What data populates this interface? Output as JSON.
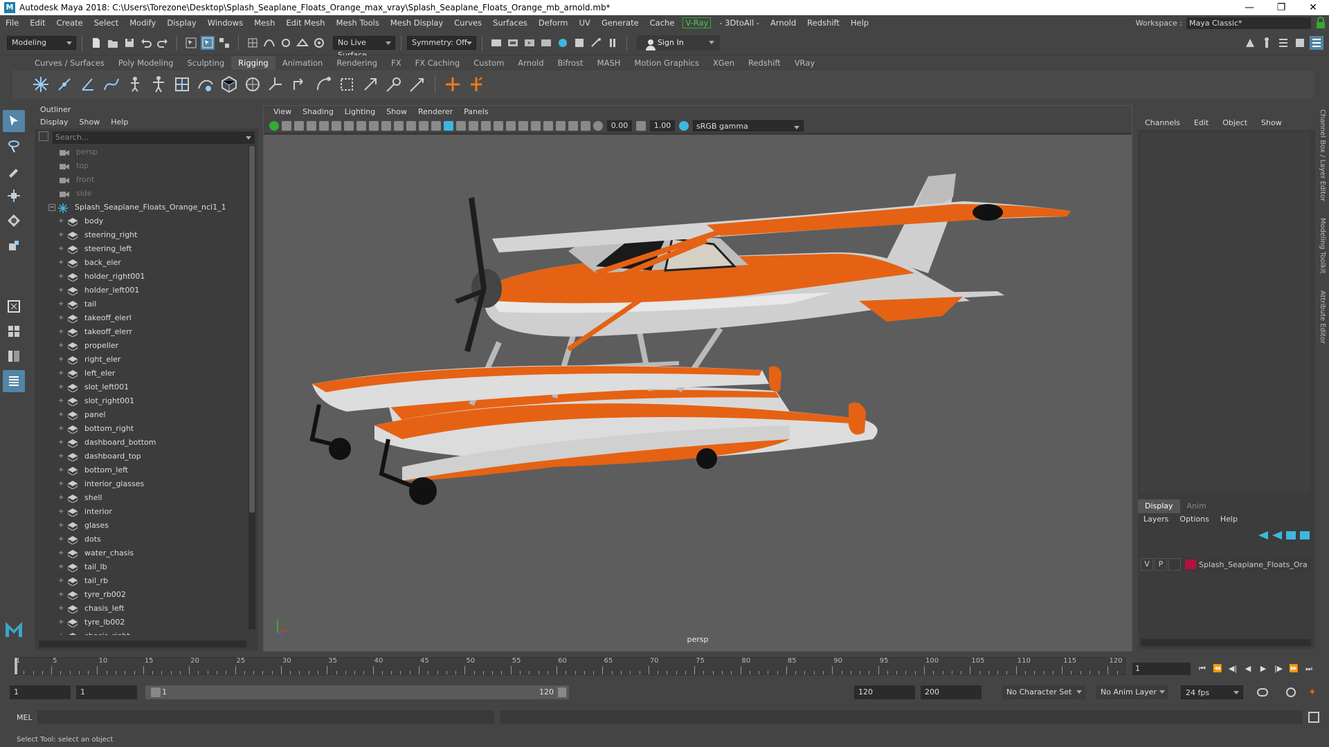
{
  "window": {
    "title": "Autodesk Maya 2018: C:\\Users\\Torezone\\Desktop\\Splash_Seaplane_Floats_Orange_max_vray\\Splash_Seaplane_Floats_Orange_mb_arnold.mb*",
    "min": "—",
    "max": "❐",
    "close": "✕"
  },
  "menubar": {
    "items": [
      "File",
      "Edit",
      "Create",
      "Select",
      "Modify",
      "Display",
      "Windows",
      "Mesh",
      "Edit Mesh",
      "Mesh Tools",
      "Mesh Display",
      "Curves",
      "Surfaces",
      "Deform",
      "UV",
      "Generate",
      "Cache",
      "V-Ray",
      "- 3DtoAll -",
      "Arnold",
      "Redshift",
      "Help"
    ],
    "workspace_label": "Workspace :",
    "workspace_value": "Maya Classic*"
  },
  "statusline": {
    "mode": "Modeling",
    "live_surface": "No Live Surface",
    "symmetry": "Symmetry: Off",
    "sign_in": "Sign In"
  },
  "shelf": {
    "tabs": [
      "Curves / Surfaces",
      "Poly Modeling",
      "Sculpting",
      "Rigging",
      "Animation",
      "Rendering",
      "FX",
      "FX Caching",
      "Custom",
      "Arnold",
      "Bifrost",
      "MASH",
      "Motion Graphics",
      "XGen",
      "Redshift",
      "VRay"
    ],
    "active_tab": "Rigging"
  },
  "outliner": {
    "title": "Outliner",
    "menu": [
      "Display",
      "Show",
      "Help"
    ],
    "search_placeholder": "Search...",
    "cameras": [
      "persp",
      "top",
      "front",
      "side"
    ],
    "group": "Splash_Seaplane_Floats_Orange_ncl1_1",
    "children": [
      "body",
      "steering_right",
      "steering_left",
      "back_eler",
      "holder_right001",
      "holder_left001",
      "tail",
      "takeoff_elerl",
      "takeoff_elerr",
      "propeller",
      "right_eler",
      "left_eler",
      "slot_left001",
      "slot_right001",
      "panel",
      "bottom_right",
      "dashboard_bottom",
      "dashboard_top",
      "bottom_left",
      "interior_glasses",
      "shell",
      "interior",
      "glases",
      "dots",
      "water_chasis",
      "tail_lb",
      "tail_rb",
      "tyre_rb002",
      "chasis_left",
      "tyre_lb002",
      "chasis_right"
    ]
  },
  "viewport": {
    "menu": [
      "View",
      "Shading",
      "Lighting",
      "Show",
      "Renderer",
      "Panels"
    ],
    "exposure": "0.00",
    "gamma": "1.00",
    "color_space": "sRGB gamma",
    "camera_label": "persp"
  },
  "channelbox": {
    "menu": [
      "Channels",
      "Edit",
      "Object",
      "Show"
    ],
    "side_tabs": [
      "Channel Box / Layer Editor",
      "Modeling Toolkit",
      "Attribute Editor"
    ]
  },
  "layer_editor": {
    "tabs": [
      "Display",
      "Anim"
    ],
    "menu": [
      "Layers",
      "Options",
      "Help"
    ],
    "layer": {
      "v": "V",
      "p": "P",
      "name": "Splash_Seaplane_Floats_Orange",
      "color": "#b3123c"
    }
  },
  "timeslider": {
    "ticks": [
      1,
      5,
      10,
      15,
      20,
      25,
      30,
      35,
      40,
      45,
      50,
      55,
      60,
      65,
      70,
      75,
      80,
      85,
      90,
      95,
      100,
      105,
      110,
      115,
      120
    ],
    "current_frame": "1",
    "play": {
      "start": "⏮",
      "prev_key": "⏪",
      "prev": "◀|",
      "back": "◀",
      "fwd": "▶",
      "next": "|▶",
      "next_key": "⏩",
      "end": "⏭"
    }
  },
  "range": {
    "start": "1",
    "playback_start": "1",
    "slider_start": "1",
    "slider_end": "120",
    "playback_end": "120",
    "end": "200",
    "character_set": "No Character Set",
    "anim_layer": "No Anim Layer",
    "fps": "24 fps"
  },
  "commandline": {
    "label": "MEL"
  },
  "helpline": {
    "text": "Select Tool: select an object"
  }
}
